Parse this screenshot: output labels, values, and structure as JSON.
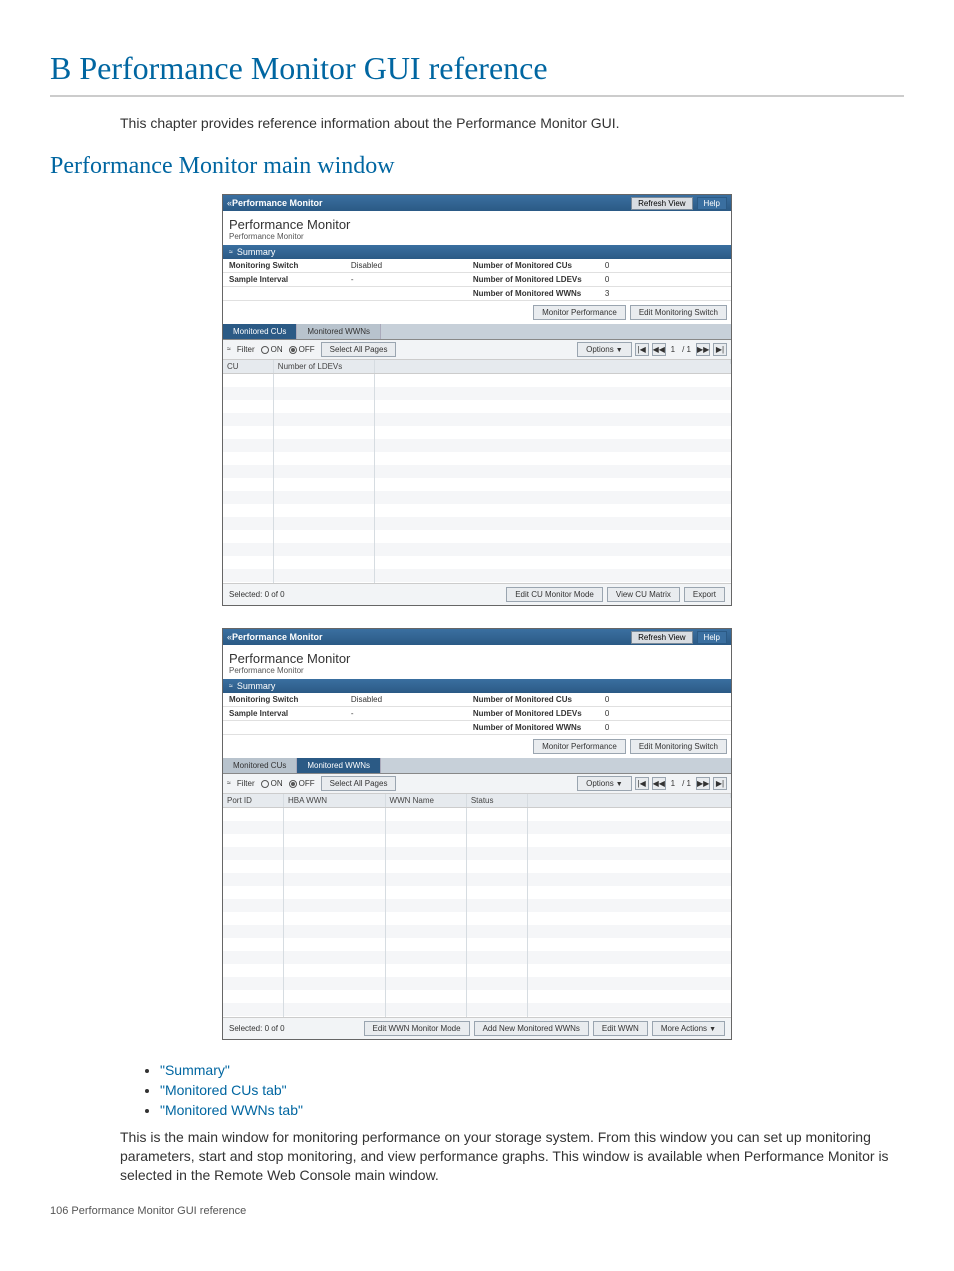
{
  "heading": "B Performance Monitor GUI reference",
  "intro": "This chapter provides reference information about the Performance Monitor GUI.",
  "section": "Performance Monitor main window",
  "window": {
    "breadcrumb_prefix": "«",
    "app_title": "Performance Monitor",
    "refresh": "Refresh View",
    "help": "Help",
    "pm_title": "Performance Monitor",
    "breadcrumb": "Performance Monitor",
    "summary_label": "Summary",
    "collapse_glyph": "≈",
    "fields": {
      "monitoring_switch_label": "Monitoring Switch",
      "monitoring_switch_value": "Disabled",
      "sample_interval_label": "Sample Interval",
      "sample_interval_value": "-",
      "num_cus_label": "Number of Monitored CUs",
      "num_cus_value": "0",
      "num_ldevs_label": "Number of Monitored LDEVs",
      "num_ldevs_value": "0",
      "num_wwns_label": "Number of Monitored WWNs",
      "num_wwns_value_a": "3",
      "num_wwns_value_b": "0"
    },
    "monitor_perf": "Monitor Performance",
    "edit_switch": "Edit Monitoring Switch",
    "tabs": {
      "cus": "Monitored CUs",
      "wwns": "Monitored WWNs"
    },
    "filter": {
      "label": "Filter",
      "on": "ON",
      "off": "OFF",
      "select_all": "Select All Pages"
    },
    "options": "Options",
    "pager": {
      "first": "|◀",
      "prev": "◀◀",
      "page": "1",
      "total": "/ 1",
      "next": "▶▶",
      "last": "▶|"
    },
    "cols_cus": {
      "cu": "CU",
      "numldevs": "Number of LDEVs"
    },
    "cols_wwns": {
      "portid": "Port ID",
      "hba": "HBA WWN",
      "wwnname": "WWN Name",
      "status": "Status"
    },
    "selected": "Selected: 0 of 0",
    "buttons1": {
      "edit_cu": "Edit CU Monitor Mode",
      "view_cu": "View CU Matrix",
      "export": "Export"
    },
    "buttons2": {
      "edit_wwn_mode": "Edit WWN Monitor Mode",
      "add_wwns": "Add New Monitored WWNs",
      "edit_wwn": "Edit WWN",
      "more": "More Actions"
    }
  },
  "bullets": [
    "\"Summary\"",
    "\"Monitored CUs tab\"",
    "\"Monitored WWNs tab\""
  ],
  "body_para": "This is the main window for monitoring performance on your storage system. From this window you can set up monitoring parameters, start and stop monitoring, and view performance graphs. This window is available when Performance Monitor is selected in the Remote Web Console main window.",
  "footer": "106   Performance Monitor GUI reference"
}
